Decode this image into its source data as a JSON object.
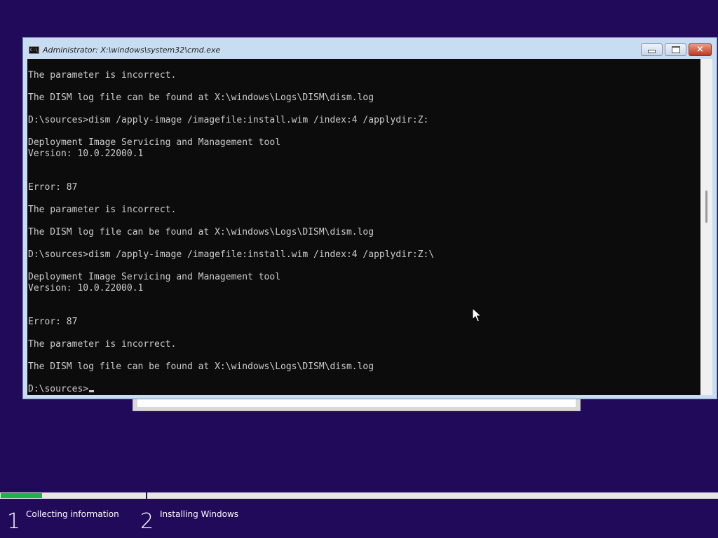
{
  "window": {
    "title": "Administrator: X:\\windows\\system32\\cmd.exe",
    "icon": "cmd-icon",
    "icon_text": "C:\\",
    "minimize_label": "minimize-icon",
    "maximize_label": "maximize-icon",
    "close_label": "×"
  },
  "console": {
    "background": "#0c0c0c",
    "foreground": "#cccccc",
    "lines": [
      "The parameter is incorrect.",
      "",
      "The DISM log file can be found at X:\\windows\\Logs\\DISM\\dism.log",
      "",
      "D:\\sources>dism /apply-image /imagefile:install.wim /index:4 /applydir:Z:",
      "",
      "Deployment Image Servicing and Management tool",
      "Version: 10.0.22000.1",
      "",
      "",
      "Error: 87",
      "",
      "The parameter is incorrect.",
      "",
      "The DISM log file can be found at X:\\windows\\Logs\\DISM\\dism.log",
      "",
      "D:\\sources>dism /apply-image /imagefile:install.wim /index:4 /applydir:Z:\\",
      "",
      "Deployment Image Servicing and Management tool",
      "Version: 10.0.22000.1",
      "",
      "",
      "Error: 87",
      "",
      "The parameter is incorrect.",
      "",
      "The DISM log file can be found at X:\\windows\\Logs\\DISM\\dism.log",
      ""
    ],
    "prompt": "D:\\sources>"
  },
  "setup": {
    "background": "#210a5a",
    "progress_color": "#21b14c",
    "progress_fraction": 0.058,
    "steps": [
      {
        "number": "1",
        "label": "Collecting information"
      },
      {
        "number": "2",
        "label": "Installing Windows"
      }
    ]
  }
}
